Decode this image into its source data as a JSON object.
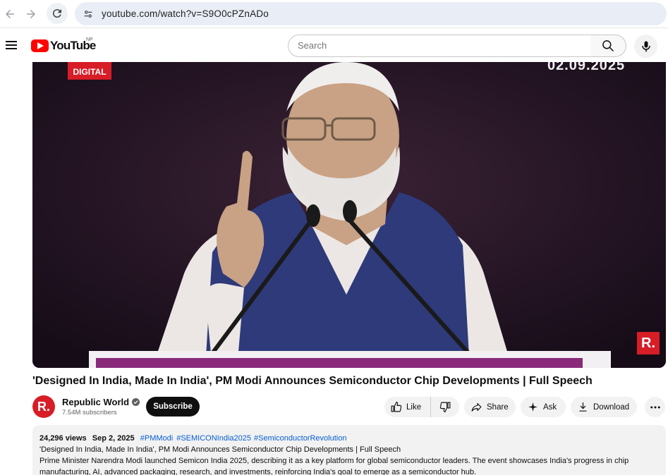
{
  "browser": {
    "url": "youtube.com/watch?v=S9O0cPZnADo"
  },
  "masthead": {
    "logo_text": "YouTube",
    "region": "NP",
    "search_placeholder": "Search"
  },
  "player": {
    "channel_bug": "DIGITAL",
    "date_overlay": "02.09.2025",
    "corner_logo": "R."
  },
  "video": {
    "title": "'Designed In India, Made In India', PM Modi Announces Semiconductor Chip Developments | Full Speech"
  },
  "channel": {
    "avatar_letter": "R.",
    "name": "Republic World",
    "subscribers": "7.54M subscribers",
    "subscribe_label": "Subscribe"
  },
  "actions": {
    "like_label": "Like",
    "share_label": "Share",
    "ask_label": "Ask",
    "download_label": "Download"
  },
  "description": {
    "views": "24,296 views",
    "date": "Sep 2, 2025",
    "tags": [
      "#PMModi",
      "#SEMICONIndia2025",
      "#SemiconductorRevolution"
    ],
    "line1": "'Designed In India, Made In India', PM Modi Announces Semiconductor Chip Developments | Full Speech",
    "line2": "Prime Minister Narendra Modi launched Semicon India 2025, describing it as a key platform for global semiconductor leaders. The event showcases India's progress in chip manufacturing, AI, advanced packaging, research, and investments, reinforcing India's goal to emerge as a semiconductor hub."
  },
  "icons": {
    "back": "arrow-left-icon",
    "forward": "arrow-right-icon",
    "reload": "reload-icon",
    "site_info": "tune-icon",
    "menu": "hamburger-icon",
    "search": "search-icon",
    "mic": "mic-icon",
    "like": "thumbs-up-icon",
    "dislike": "thumbs-down-icon",
    "share": "share-icon",
    "ask": "sparkle-icon",
    "download": "download-icon",
    "more": "more-icon"
  },
  "colors": {
    "brand_red": "#ff0000",
    "channel_red": "#d71d26",
    "link_blue": "#065fd4",
    "omnibox_bg": "#e9eef6"
  }
}
